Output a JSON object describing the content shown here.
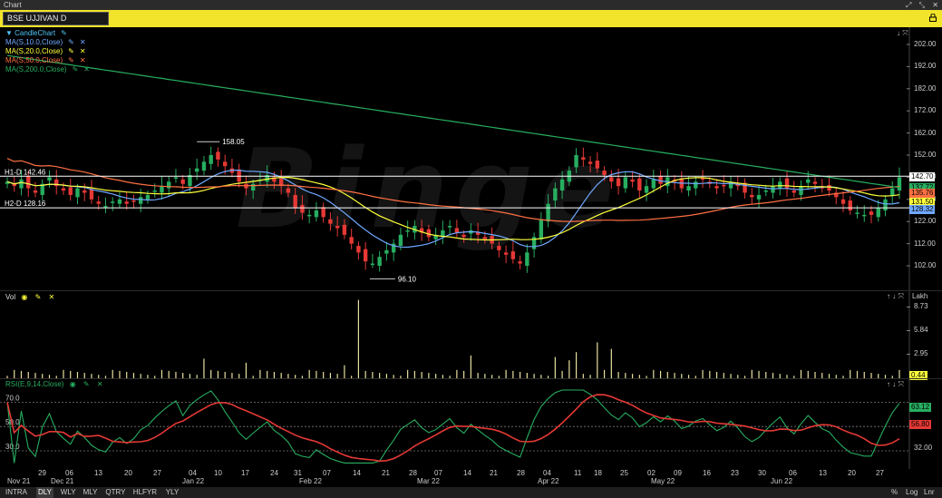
{
  "window": {
    "title": "Chart",
    "controls": [
      "⤢",
      "⤡",
      "✕"
    ]
  },
  "header": {
    "symbol": "BSE UJJIVAN D"
  },
  "price_panel": {
    "legend": [
      {
        "label": "CandleChart",
        "color": "#4fc3f7",
        "icon": "pencil-icon",
        "has_close": false,
        "prefix": "▼ "
      },
      {
        "label": "MA(S,10.0,Close)",
        "color": "#6fa8ff",
        "icon": "pencil-icon",
        "has_close": true
      },
      {
        "label": "MA(S,20.0,Close)",
        "color": "#ffff3c",
        "icon": "pencil-icon",
        "has_close": true
      },
      {
        "label": "MA(S,50.0,Close)",
        "color": "#ff7043",
        "icon": "pencil-icon",
        "has_close": true
      },
      {
        "label": "MA(S,200.0,Close)",
        "color": "#27ae60",
        "icon": "pencil-icon",
        "has_close": true
      }
    ],
    "y_ticks": [
      "202.00",
      "192.00",
      "182.00",
      "172.00",
      "162.00",
      "152.00",
      "142.00",
      "132.00",
      "122.00",
      "112.00",
      "102.00"
    ],
    "hline1_label": "H1-D 142.46",
    "hline2_label": "H2-D 128.16",
    "high_annotation": "158.05",
    "low_annotation": "96.10",
    "tags": [
      {
        "text": "142.70",
        "bg": "#ffffff",
        "fg": "#000000"
      },
      {
        "text": "137.72",
        "bg": "#27ae60",
        "fg": "#000000"
      },
      {
        "text": "135.76",
        "bg": "#ff7043",
        "fg": "#000000"
      },
      {
        "text": "131.50",
        "bg": "#ffff3c",
        "fg": "#000000"
      },
      {
        "text": "128.32",
        "bg": "#6fa8ff",
        "fg": "#000000"
      }
    ],
    "watermark": "Binge"
  },
  "vol_panel": {
    "label": "Vol",
    "unit": "Lakh",
    "y_ticks": [
      "8.73",
      "5.84",
      "2.95"
    ],
    "tag": "0.44"
  },
  "rsi_panel": {
    "label": "RSI(E,9,14,Close)",
    "levels": [
      "70.0",
      "50.0",
      "30.0"
    ],
    "y_ticks": [
      "32.00"
    ],
    "tags": [
      {
        "text": "63.12",
        "bg": "#27ae60"
      },
      {
        "text": "56.80",
        "bg": "#e53935"
      }
    ]
  },
  "x_axis": {
    "days": [
      "29",
      "06",
      "13",
      "20",
      "27",
      "04",
      "10",
      "17",
      "24",
      "31",
      "07",
      "14",
      "21",
      "28",
      "07",
      "14",
      "21",
      "28",
      "04",
      "11",
      "18",
      "25",
      "02",
      "09",
      "16",
      "23",
      "30",
      "06",
      "13",
      "20",
      "27"
    ],
    "months": [
      "Nov 21",
      "Dec 21",
      "Jan 22",
      "Feb 22",
      "Mar 22",
      "Apr 22",
      "May 22",
      "Jun 22"
    ]
  },
  "bottom_bar": {
    "timeframes": [
      "INTRA",
      "DLY",
      "WLY",
      "MLY",
      "QTRY",
      "HLFYR",
      "YLY"
    ],
    "selected": "DLY",
    "right": [
      "%",
      "Log",
      "Lnr"
    ]
  },
  "colors": {
    "up": "#27ae60",
    "down": "#e53935",
    "header": "#f2e42a",
    "ma10": "#6fa8ff",
    "ma20": "#ffff3c",
    "ma50": "#ff7043",
    "ma200": "#27ae60",
    "rsi": "#27ae60",
    "rsi_signal": "#e53935",
    "volume": "#e8e0a0"
  }
}
